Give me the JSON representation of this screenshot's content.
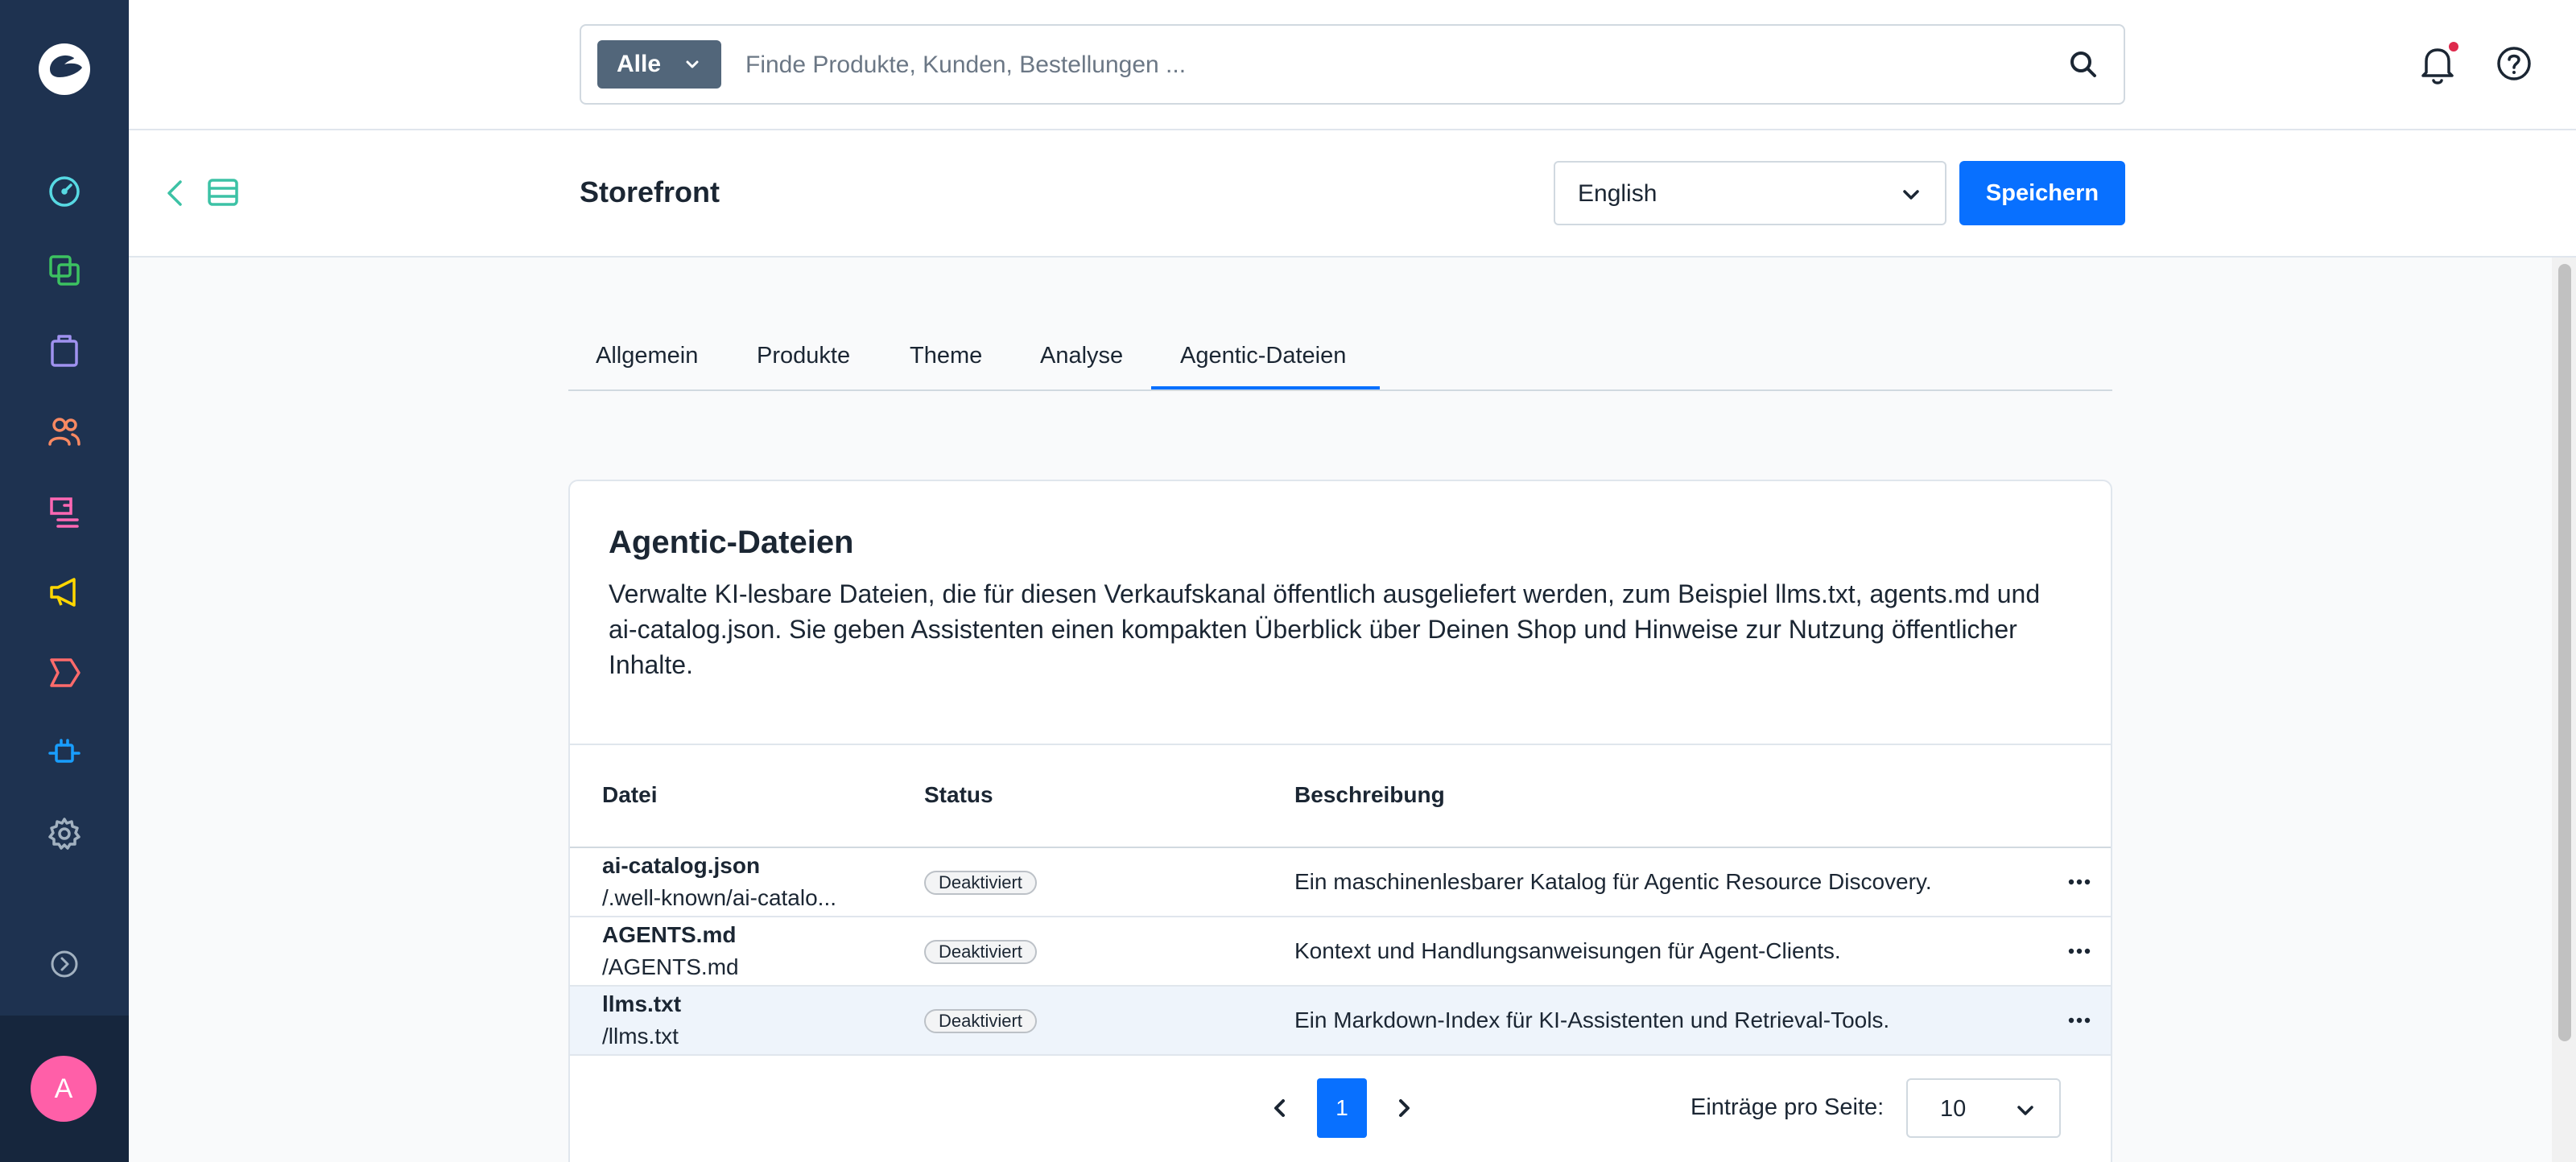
{
  "topbar": {
    "search_scope": "Alle",
    "search_placeholder": "Finde Produkte, Kunden, Bestellungen ..."
  },
  "smartbar": {
    "title": "Storefront",
    "language": "English",
    "save_label": "Speichern"
  },
  "tabs": [
    "Allgemein",
    "Produkte",
    "Theme",
    "Analyse",
    "Agentic-Dateien"
  ],
  "active_tab": "Agentic-Dateien",
  "card": {
    "title": "Agentic-Dateien",
    "description": "Verwalte KI-lesbare Dateien, die für diesen Verkaufskanal öffentlich ausgeliefert werden, zum Beispiel llms.txt, agents.md und ai-catalog.json. Sie geben Assistenten einen kompakten Überblick über Deinen Shop und Hinweise zur Nutzung öffentlicher Inhalte."
  },
  "table": {
    "headers": [
      "Datei",
      "Status",
      "Beschreibung"
    ],
    "rows": [
      {
        "name": "ai-catalog.json",
        "path": "/.well-known/ai-catalo...",
        "status": "Deaktiviert",
        "description": "Ein maschinenlesbarer Katalog für Agentic Resource Discovery."
      },
      {
        "name": "AGENTS.md",
        "path": "/AGENTS.md",
        "status": "Deaktiviert",
        "description": "Kontext und Handlungsanweisungen für Agent-Clients."
      },
      {
        "name": "llms.txt",
        "path": "/llms.txt",
        "status": "Deaktiviert",
        "description": "Ein Markdown-Index für KI-Assistenten und Retrieval-Tools."
      }
    ]
  },
  "pagination": {
    "current_page": "1",
    "per_page_label": "Einträge pro Seite:",
    "per_page_value": "10"
  },
  "user": {
    "avatar_initial": "A"
  },
  "colors": {
    "sidebar": "#1e3250",
    "primary": "#0870ff",
    "avatar": "#ff5fa8",
    "notification_dot": "#de294c"
  },
  "sidebar_icons": [
    "dashboard-icon",
    "catalog-icon",
    "orders-icon",
    "customers-icon",
    "content-icon",
    "marketing-icon",
    "sales-channel-icon",
    "extensions-icon",
    "settings-icon"
  ]
}
